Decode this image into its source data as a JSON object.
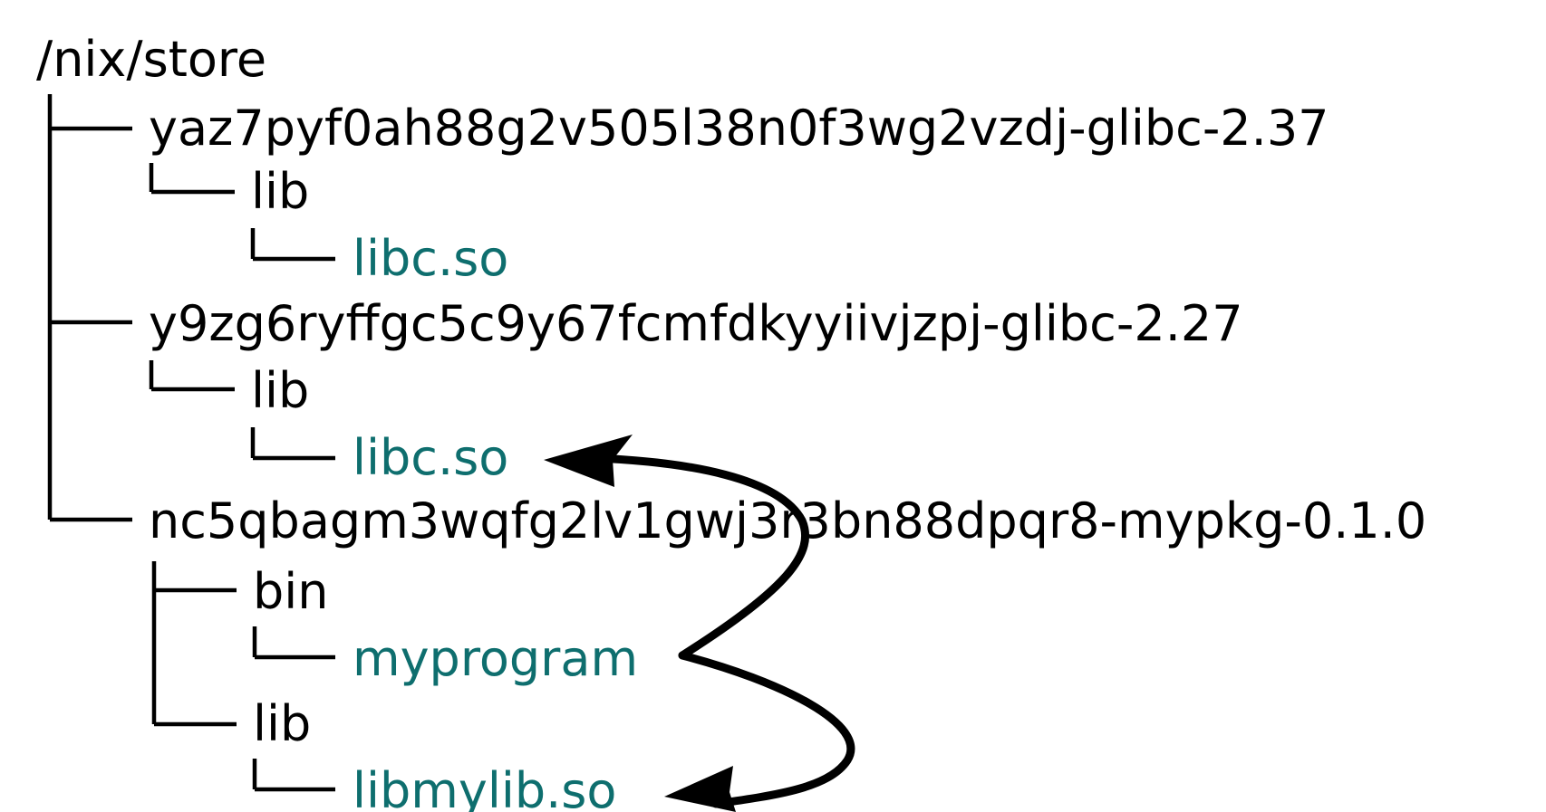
{
  "root": {
    "name": "/nix/store"
  },
  "packages": [
    {
      "name": "yaz7pyf0ah88g2v505l38n0f3wg2vzdj-glibc-2.37",
      "children": [
        {
          "name": "lib",
          "children": [
            {
              "name": "libc.so",
              "kind": "file"
            }
          ]
        }
      ]
    },
    {
      "name": "y9zg6ryffgc5c9y67fcmfdkyyiivjzpj-glibc-2.27",
      "children": [
        {
          "name": "lib",
          "children": [
            {
              "name": "libc.so",
              "kind": "file"
            }
          ]
        }
      ]
    },
    {
      "name": "nc5qbagm3wqfg2lv1gwj3r3bn88dpqr8-mypkg-0.1.0",
      "children": [
        {
          "name": "bin",
          "children": [
            {
              "name": "myprogram",
              "kind": "file"
            }
          ]
        },
        {
          "name": "lib",
          "children": [
            {
              "name": "libmylib.so",
              "kind": "file"
            }
          ]
        }
      ]
    }
  ],
  "links": [
    {
      "from": "myprogram",
      "to": "y9zg6ryffgc5c9y67fcmfdkyyiivjzpj-glibc-2.27/lib/libc.so"
    },
    {
      "from": "myprogram",
      "to": "nc5qbagm3wqfg2lv1gwj3r3bn88dpqr8-mypkg-0.1.0/lib/libmylib.so"
    }
  ],
  "colors": {
    "directory": "#000000",
    "file": "#0e6e6e",
    "background": "#ffffff"
  }
}
